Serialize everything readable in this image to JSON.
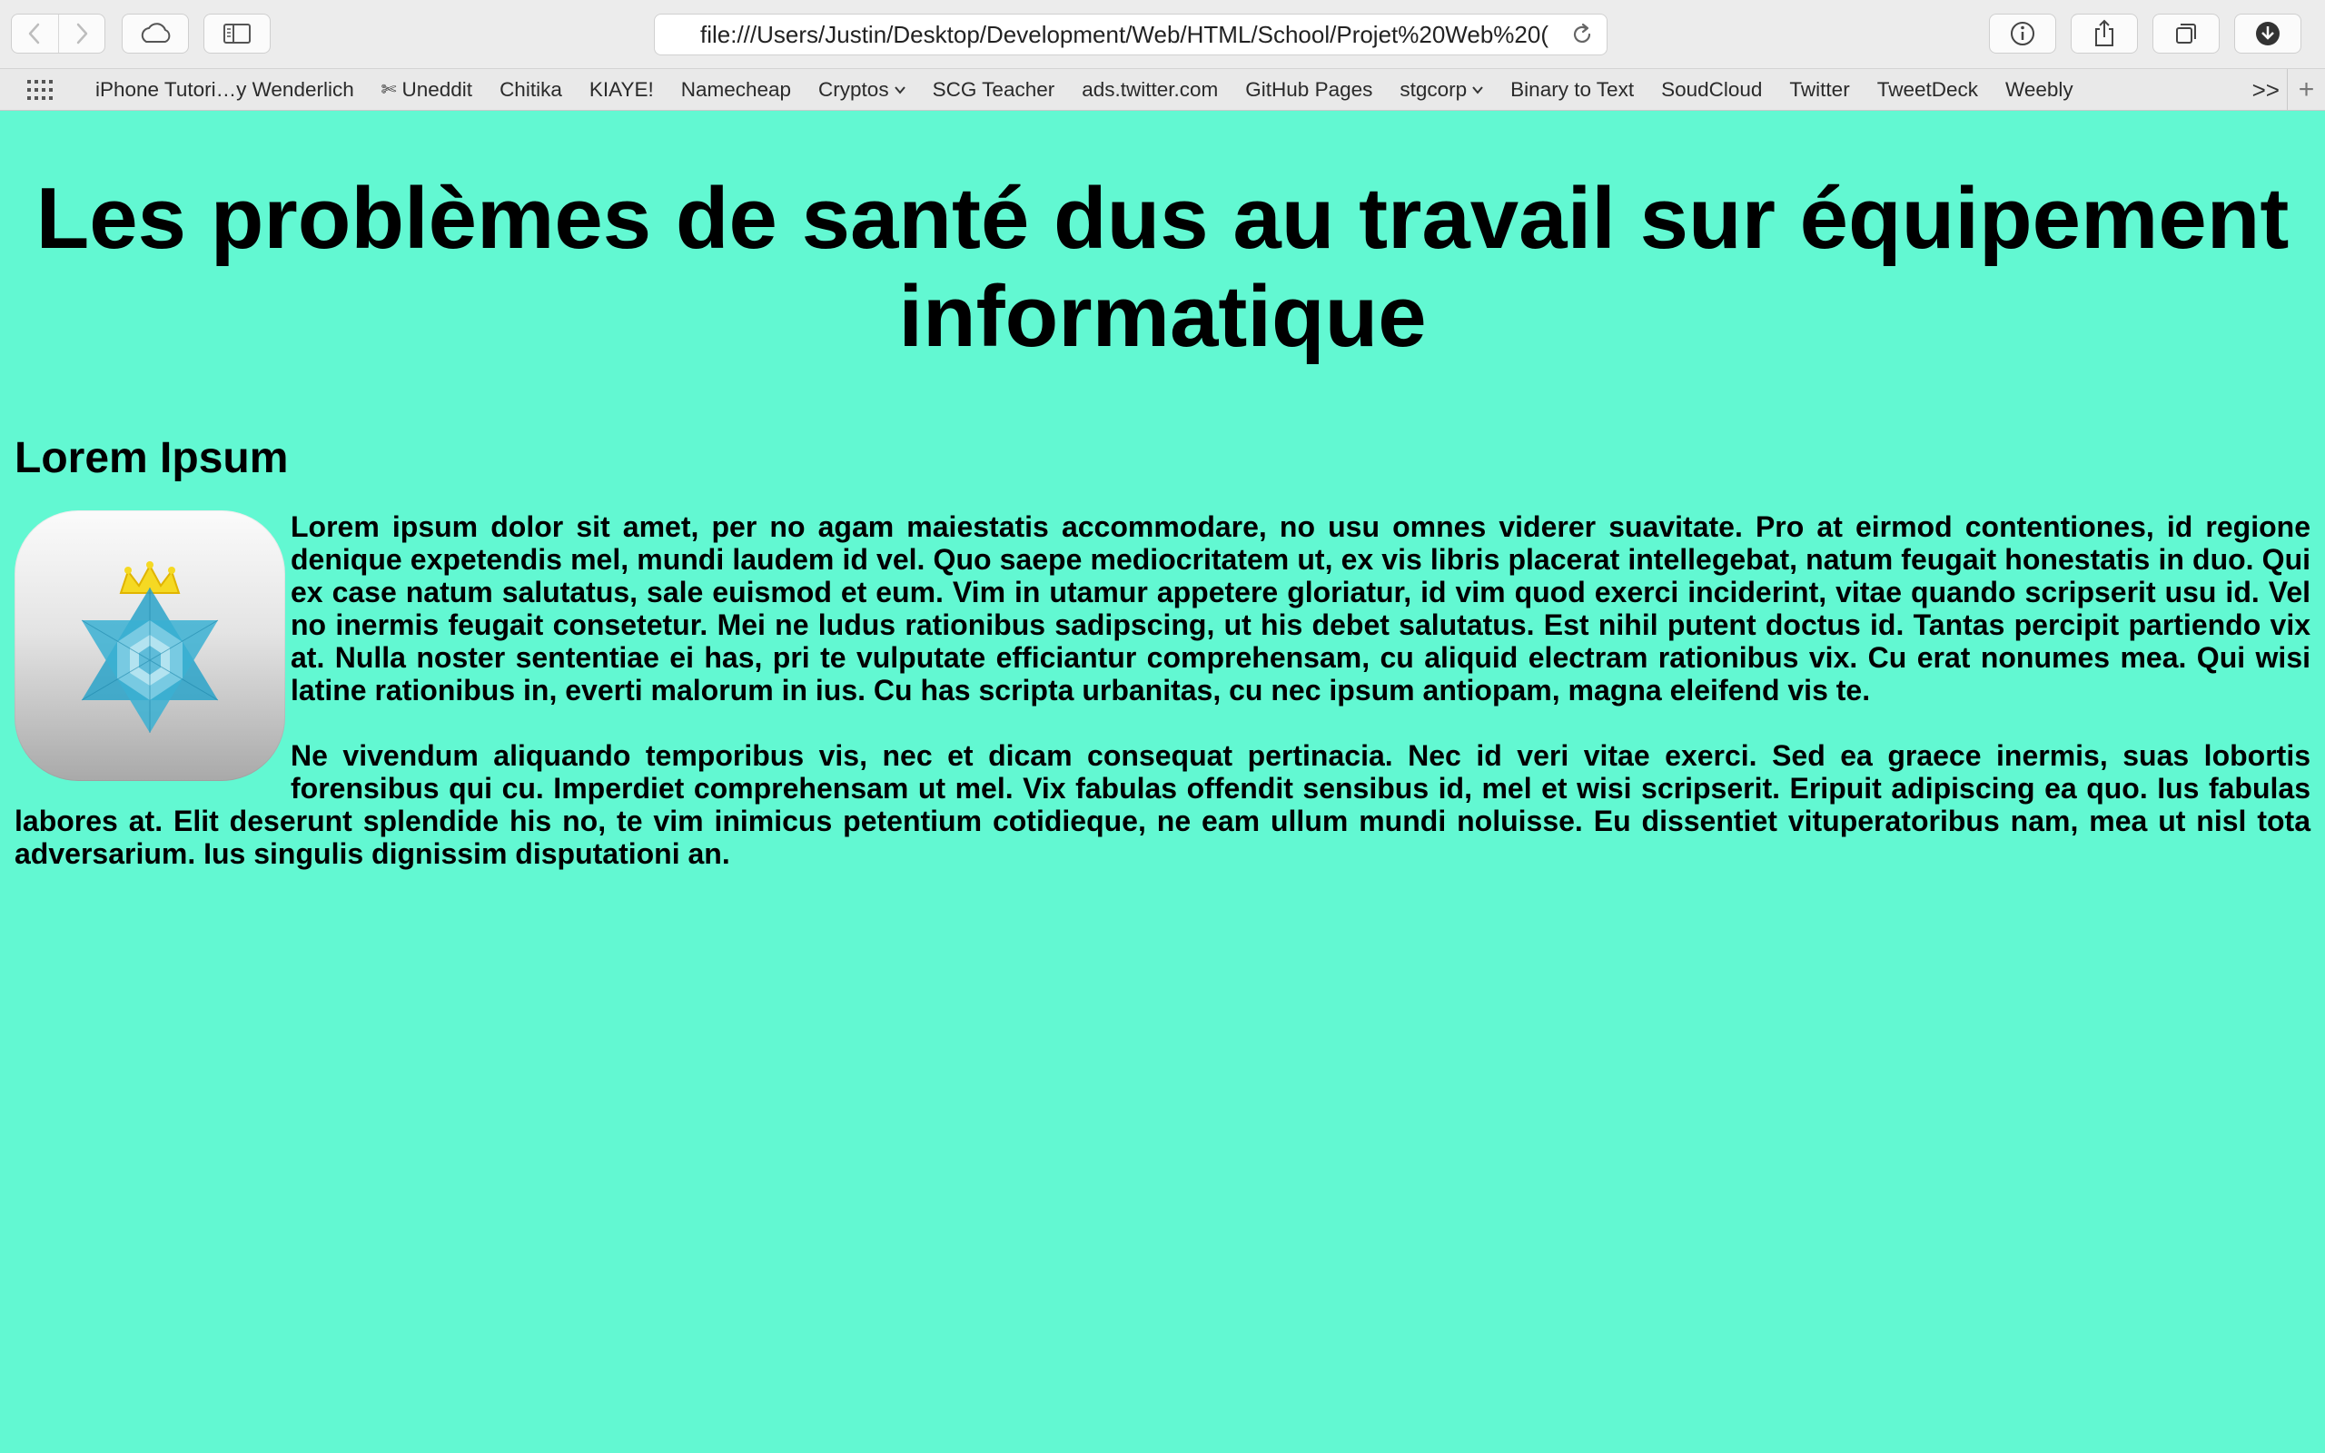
{
  "browser": {
    "url": "file:///Users/Justin/Desktop/Development/Web/HTML/School/Projet%20Web%20(",
    "bookmarks": [
      {
        "label": "iPhone Tutori…y Wenderlich"
      },
      {
        "label": "Uneddit",
        "icon": "scissors-icon"
      },
      {
        "label": "Chitika"
      },
      {
        "label": "KIAYE!"
      },
      {
        "label": "Namecheap"
      },
      {
        "label": "Cryptos",
        "dropdown": true
      },
      {
        "label": "SCG Teacher"
      },
      {
        "label": "ads.twitter.com"
      },
      {
        "label": "GitHub Pages"
      },
      {
        "label": "stgcorp",
        "dropdown": true
      },
      {
        "label": "Binary to Text"
      },
      {
        "label": "SoudCloud"
      },
      {
        "label": "Twitter"
      },
      {
        "label": "TweetDeck"
      },
      {
        "label": "Weebly"
      }
    ],
    "overflow_label": ">>",
    "add_tab_label": "+"
  },
  "page": {
    "background": "#62f8d2",
    "title": "Les problèmes de santé dus au travail sur équipement informatique",
    "section_heading": "Lorem Ipsum",
    "logo_icon": "star-of-david-crown-icon",
    "paragraphs": [
      "Lorem ipsum dolor sit amet, per no agam maiestatis accommodare, no usu omnes viderer suavitate. Pro at eirmod contentiones, id regione denique expetendis mel, mundi laudem id vel. Quo saepe mediocritatem ut, ex vis libris placerat intellegebat, natum feugait honestatis in duo. Qui ex case natum salutatus, sale euismod et eum. Vim in utamur appetere gloriatur, id vim quod exerci inciderint, vitae quando scripserit usu id. Vel no inermis feugait consetetur. Mei ne ludus rationibus sadipscing, ut his debet salutatus. Est nihil putent doctus id. Tantas percipit partiendo vix at. Nulla noster sententiae ei has, pri te vulputate efficiantur comprehensam, cu aliquid electram rationibus vix. Cu erat nonumes mea. Qui wisi latine rationibus in, everti malorum in ius. Cu has scripta urbanitas, cu nec ipsum antiopam, magna eleifend vis te.",
      "Ne vivendum aliquando temporibus vis, nec et dicam consequat pertinacia. Nec id veri vitae exerci. Sed ea graece inermis, suas lobortis forensibus qui cu. Imperdiet comprehensam ut mel. Vix fabulas offendit sensibus id, mel et wisi scripserit. Eripuit adipiscing ea quo. Ius fabulas labores at. Elit deserunt splendide his no, te vim inimicus petentium cotidieque, ne eam ullum mundi noluisse. Eu dissentiet vituperatoribus nam, mea ut nisl tota adversarium. Ius singulis dignissim disputationi an."
    ]
  }
}
